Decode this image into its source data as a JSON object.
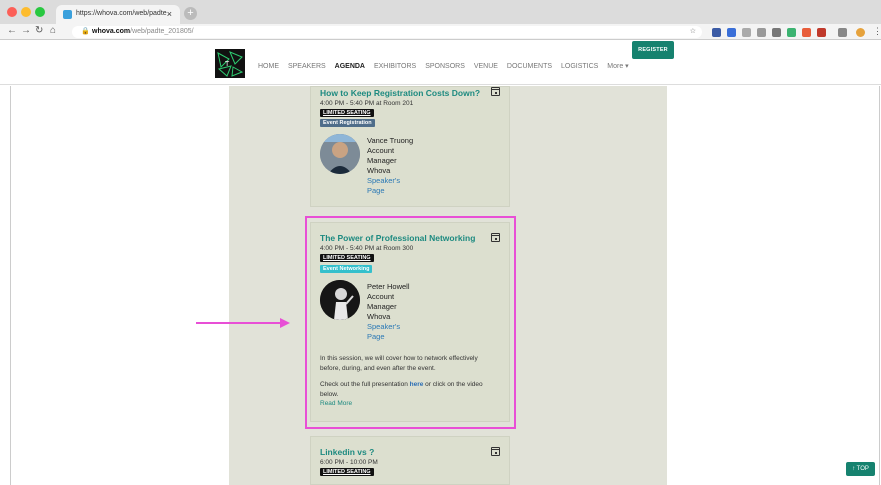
{
  "browser": {
    "tab_title": "https://whova.com/web/padte",
    "tab_close": "×",
    "new_tab": "+",
    "url_domain": "whova.com",
    "url_path": "/web/padte_201805/"
  },
  "header": {
    "nav": [
      "HOME",
      "SPEAKERS",
      "AGENDA",
      "EXHIBITORS",
      "SPONSORS",
      "VENUE",
      "DOCUMENTS",
      "LOGISTICS",
      "More ▾"
    ],
    "register_label": "REGISTER"
  },
  "sessions": [
    {
      "title": "How to Keep Registration Costs Down?",
      "time": "4:00 PM - 5:40 PM at Room 201",
      "badge": "LIMITED SEATING",
      "tag": "Event Registration",
      "tag_color": "#4f6d8a",
      "speaker": {
        "name": "Vance Truong",
        "role1": "Account",
        "role2": "Manager",
        "org": "Whova",
        "link1": "Speaker's",
        "link2": "Page"
      }
    },
    {
      "title": "The Power of Professional Networking",
      "time": "4:00 PM - 5:40 PM at Room 300",
      "badge": "LIMITED SEATING",
      "tag": "Event Networking",
      "tag_color": "#35c0cc",
      "speaker": {
        "name": "Peter Howell",
        "role1": "Account",
        "role2": "Manager",
        "org": "Whova",
        "link1": "Speaker's",
        "link2": "Page"
      },
      "desc1_line1": "In this session, we will cover how to network effectively",
      "desc1_line2": "before, during, and even after the event.",
      "desc2_pre": "Check out the full presentation ",
      "desc2_link": "here",
      "desc2_post": " or click on the video",
      "desc2_line2": "below.",
      "read_more": "Read More"
    },
    {
      "title": "Linkedin vs ?",
      "time": "6:00 PM - 10:00 PM",
      "badge": "LIMITED SEATING"
    }
  ],
  "to_top_label": "↑ TOP",
  "colors": {
    "accent": "#16826f",
    "title": "#1d8a80",
    "highlight": "#e84fd6"
  }
}
